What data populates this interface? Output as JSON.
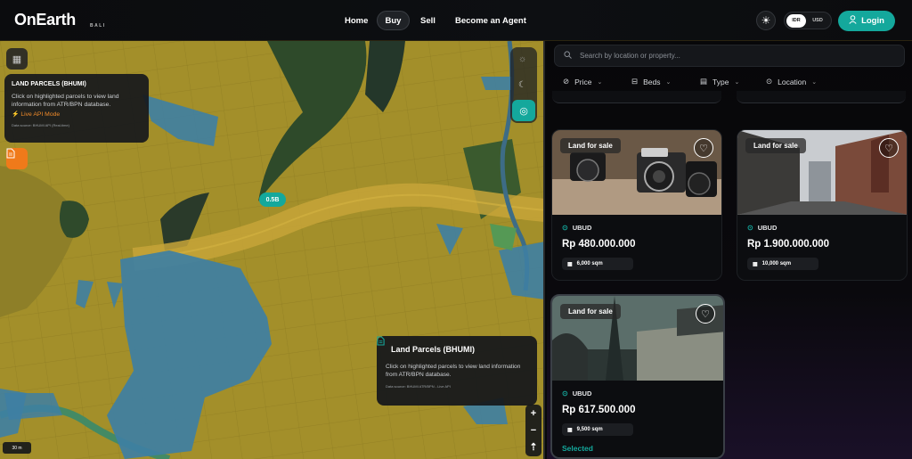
{
  "header": {
    "logo": "OnEarth",
    "logo_sub": "BALI",
    "nav": {
      "home": "Home",
      "buy": "Buy",
      "sell": "Sell",
      "agent": "Become an Agent"
    },
    "currency": {
      "idr": "IDR",
      "usd": "USD",
      "selected": "IDR"
    },
    "login": "Login"
  },
  "map": {
    "info_small": {
      "title": "LAND PARCELS (BHUMI)",
      "desc": "Click on highlighted parcels to view land information from ATR/BPN database.",
      "live": "Live API Mode",
      "source": "Data source: BHUMI API (Real-time)"
    },
    "marker": "0.5B",
    "info_big": {
      "title": "Land Parcels (BHUMI)",
      "desc": "Click on highlighted parcels to view land information from ATR/BPN database.",
      "source": "Data source: BHUMI ATR/BPN - Live API"
    },
    "zoom_in": "+",
    "zoom_out": "−",
    "compass": "⇡",
    "scale": "30 m"
  },
  "panel": {
    "search_placeholder": "Search by location or property...",
    "filters": {
      "price": "Price",
      "beds": "Beds",
      "type": "Type",
      "location": "Location"
    },
    "listings": [
      {
        "badge": "Land for sale",
        "location": "UBUD",
        "price": "Rp 480.000.000",
        "size": "6,000 sqm",
        "image": "cameras"
      },
      {
        "badge": "Land for sale",
        "location": "UBUD",
        "price": "Rp 1.900.000.000",
        "size": "10,000 sqm",
        "image": "street"
      },
      {
        "badge": "Land for sale",
        "location": "UBUD",
        "price": "Rp 617.500.000",
        "size": "9,500 sqm",
        "image": "eiffel",
        "selected_label": "Selected"
      }
    ]
  },
  "colors": {
    "accent": "#14a89c",
    "orange": "#f07a1a",
    "parcel_yellow": "#a38f2a",
    "parcel_blue": "#3e7fa3"
  }
}
